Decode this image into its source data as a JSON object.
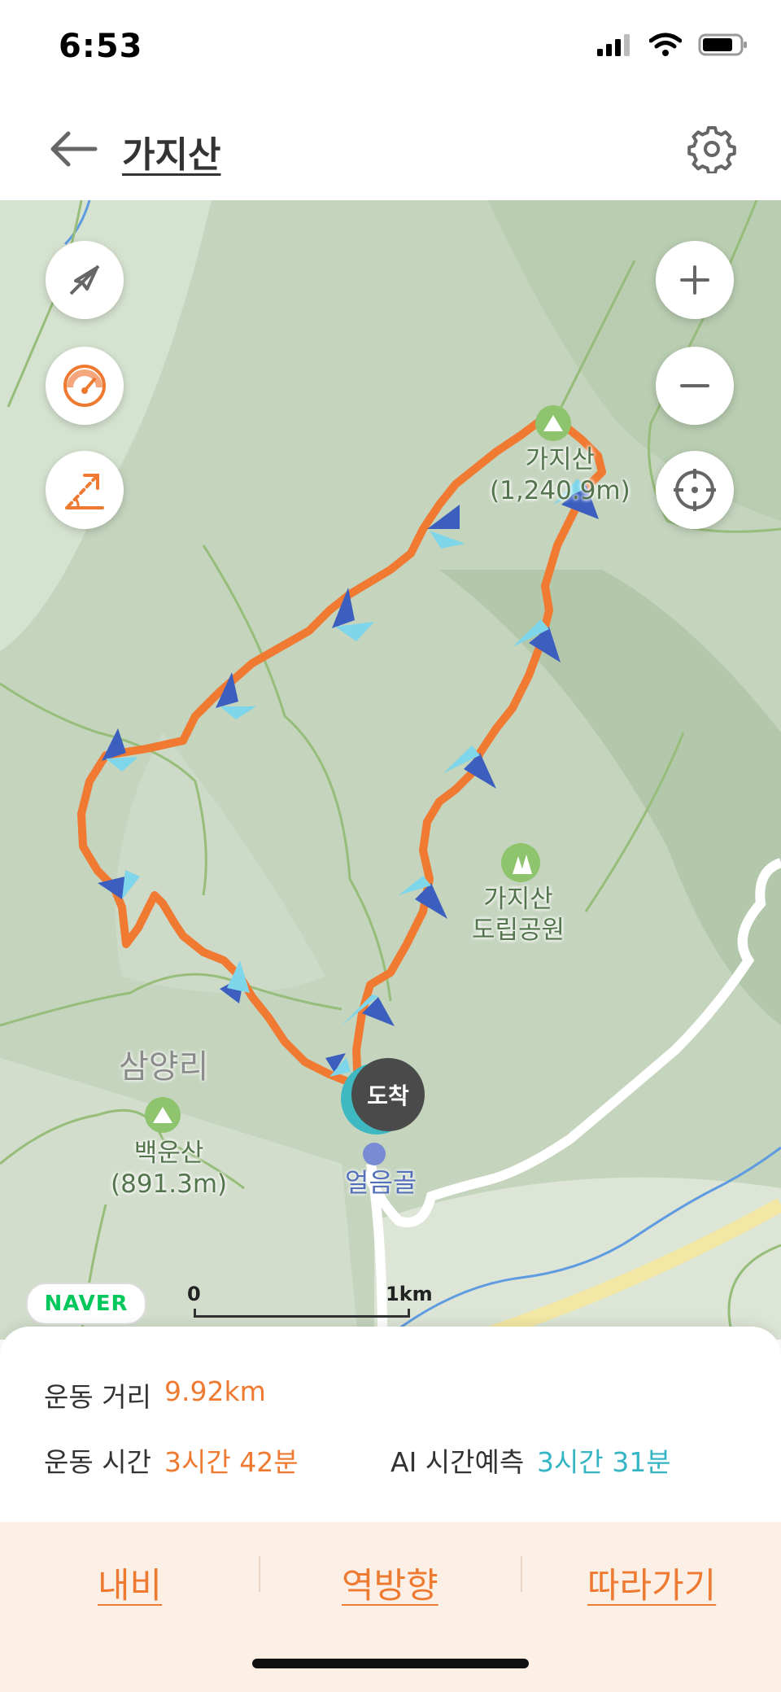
{
  "status_bar": {
    "time": "6:53"
  },
  "header": {
    "title": "가지산"
  },
  "map": {
    "labels": {
      "peak_main_name": "가지산",
      "peak_main_elev": "(1,240.9m)",
      "park_line1": "가지산",
      "park_line2": "도립공원",
      "village": "삼양리",
      "peak2_name": "백운산",
      "peak2_elev": "(891.3m)",
      "end_point": "얼음골"
    },
    "arrive_marker": "도착",
    "brand": "NAVER",
    "scale": {
      "start": "0",
      "end": "1km"
    }
  },
  "stats": {
    "distance_label": "운동 거리",
    "distance_value": "9.92km",
    "time_label": "운동 시간",
    "time_value": "3시간 42분",
    "ai_label": "AI 시간예측",
    "ai_value": "3시간 31분"
  },
  "actions": {
    "navigate": "내비",
    "reverse": "역방향",
    "follow": "따라가기"
  },
  "colors": {
    "route": "#f07a32",
    "accent_orange": "#ee7a32",
    "accent_teal": "#35b5c4",
    "map_bg": "#c9d8c3"
  },
  "icons": [
    "signal-icon",
    "wifi-icon",
    "battery-icon",
    "back-arrow-icon",
    "gear-icon",
    "compass-off-icon",
    "speedometer-icon",
    "elevation-icon",
    "zoom-in-icon",
    "zoom-out-icon",
    "locate-icon",
    "mountain-icon",
    "tree-icon"
  ]
}
